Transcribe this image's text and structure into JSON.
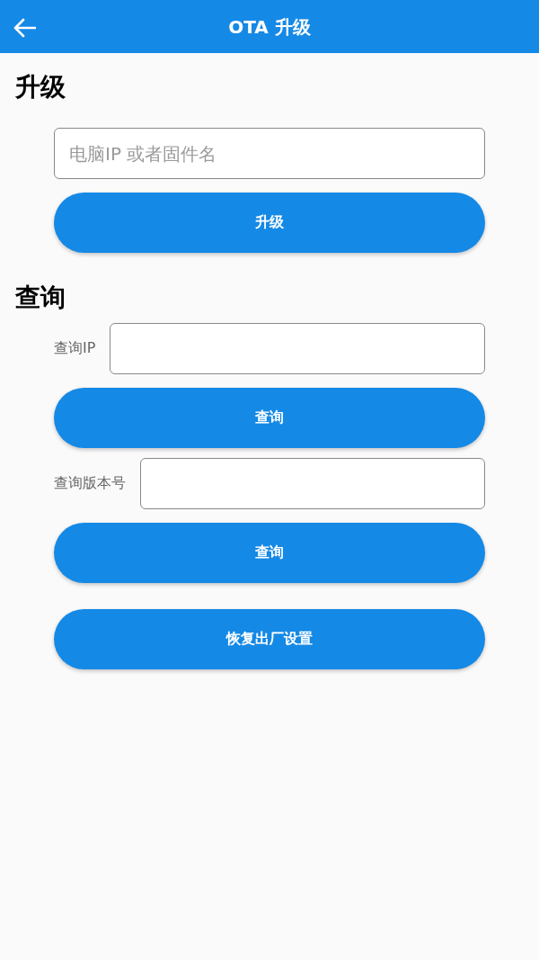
{
  "app_bar": {
    "title": "OTA 升级"
  },
  "sections": [
    {
      "heading": "升级",
      "items": [
        {
          "kind": "field",
          "placeholder": "电脑IP 或者固件名"
        },
        {
          "kind": "button",
          "label": "升级"
        }
      ]
    },
    {
      "heading": "查询",
      "items": [
        {
          "kind": "labeled_field",
          "label": "查询IP"
        },
        {
          "kind": "button",
          "label": "查询"
        },
        {
          "kind": "labeled_field",
          "label": "查询版本号"
        },
        {
          "kind": "button",
          "label": "查询"
        }
      ]
    }
  ],
  "reset_button": {
    "label": "恢复出厂设置"
  }
}
